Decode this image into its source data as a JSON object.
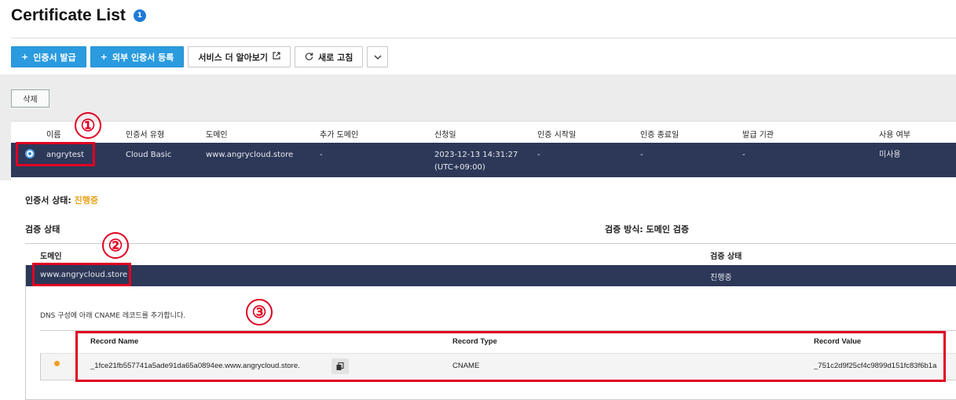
{
  "header": {
    "title": "Certificate List",
    "badge": "1"
  },
  "toolbar": {
    "issue_label": "인증서 발급",
    "register_external_label": "외부 인증서 등록",
    "learn_more_label": "서비스 더 알아보기",
    "refresh_label": "새로 고침"
  },
  "actions": {
    "delete_label": "삭제"
  },
  "table": {
    "columns": [
      "이름",
      "인증서 유형",
      "도메인",
      "추가 도메인",
      "신청일",
      "인증 시작일",
      "인증 종료일",
      "발급 기관",
      "사용 여부"
    ],
    "row": {
      "name": "angrytest",
      "type": "Cloud Basic",
      "domain": "www.angrycloud.store",
      "extra_domain": "-",
      "requested_date": "2023-12-13 14:31:27",
      "requested_tz": "(UTC+09:00)",
      "start_date": "-",
      "end_date": "-",
      "issuer": "-",
      "usage": "미사용"
    }
  },
  "detail": {
    "cert_status_label": "인증서 상태:",
    "cert_status_value": "진행중",
    "verify_title": "검증 상태",
    "verify_method": "검증 방식: 도메인 검증",
    "domain_table": {
      "col_domain": "도메인",
      "col_status": "검증 상태",
      "domain": "www.angrycloud.store",
      "status": "진행중"
    },
    "dns_description": "DNS 구성에 아래 CNAME 레코드를 추가합니다.",
    "record_table": {
      "col_name": "Record Name",
      "col_type": "Record Type",
      "col_value": "Record Value",
      "name": "_1fce21fb557741a5ade91da65a0894ee.www.angrycloud.store.",
      "type": "CNAME",
      "value": "_751c2d9f25cf4c9899d151fc83f6b1a"
    }
  },
  "annotations": {
    "marker1": "①",
    "marker2": "②",
    "marker3": "③",
    "color": "#e00022"
  }
}
